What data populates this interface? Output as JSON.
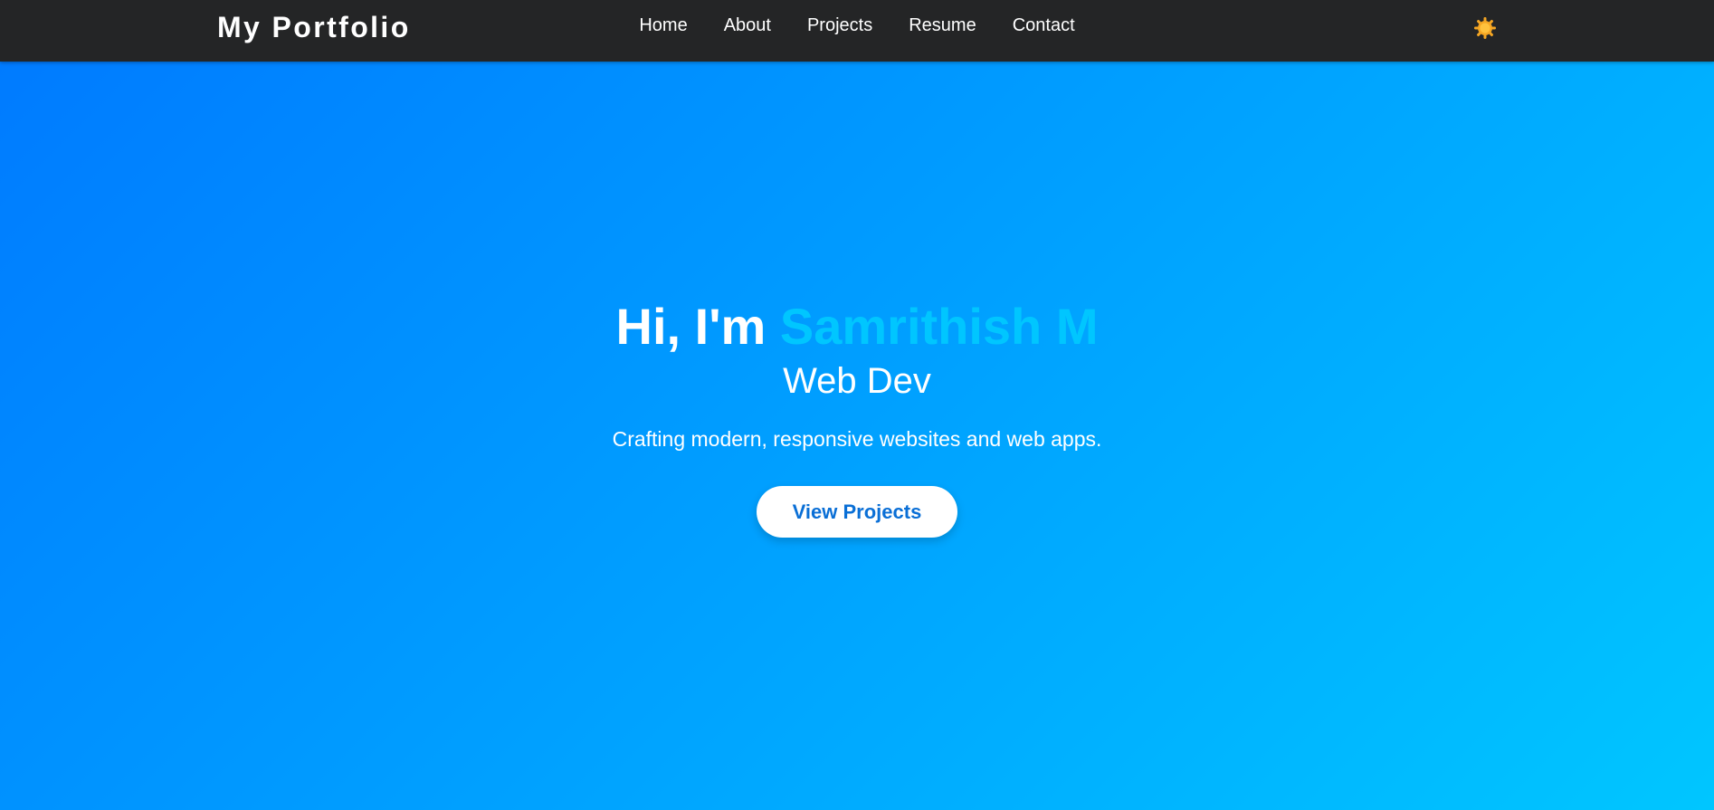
{
  "navbar": {
    "brand": "My Portfolio",
    "links": [
      {
        "label": "Home"
      },
      {
        "label": "About"
      },
      {
        "label": "Projects"
      },
      {
        "label": "Resume"
      },
      {
        "label": "Contact"
      }
    ],
    "theme_toggle_icon": "sun-icon"
  },
  "hero": {
    "greeting": "Hi, I'm ",
    "name": "Samrithish M",
    "role": "Web Dev",
    "tagline": "Crafting modern, responsive websites and web apps.",
    "cta_label": "View Projects"
  },
  "colors": {
    "navbar_bg": "#242526",
    "hero_gradient_start": "#007bff",
    "hero_gradient_end": "#00c6ff",
    "name_accent": "#00c6ff",
    "cta_text": "#0a6fd6",
    "sun": "#f5a623"
  }
}
